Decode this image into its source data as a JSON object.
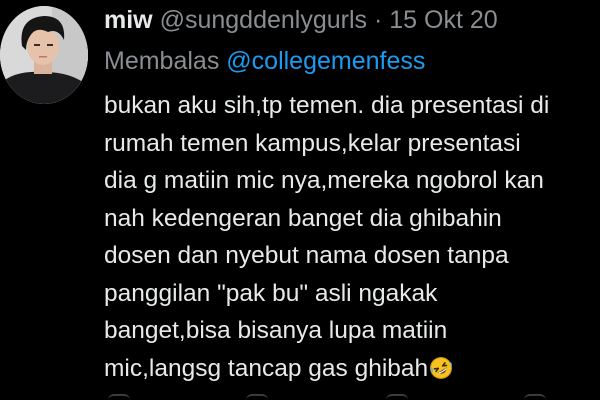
{
  "tweet": {
    "display_name": "miw",
    "handle": "@sungddenlygurls",
    "separator": "·",
    "date": "15 Okt 20",
    "reply_prefix": "Membalas",
    "reply_to": "@collegemenfess",
    "body_lines": [
      "bukan aku sih,tp temen. dia presentasi di",
      "rumah temen kampus,kelar presentasi",
      "dia g matiin mic nya,mereka ngobrol kan",
      "nah kedengeran banget dia ghibahin",
      "dosen dan nyebut nama dosen tanpa",
      "panggilan \"pak bu\" asli ngakak",
      "banget,bisa bisanya lupa matiin",
      "mic,langsg tancap gas ghibah"
    ],
    "body_emoji": "rolling-on-floor-laughing-emoji"
  },
  "colors": {
    "background": "#000000",
    "text": "#e7e9ea",
    "secondary": "#8a8d91",
    "mention": "#1d9bf0",
    "emoji": "#f7c21f"
  },
  "icons": {
    "avatar": "profile-photo",
    "actions": [
      "reply-icon",
      "retweet-icon",
      "like-icon",
      "share-icon"
    ]
  }
}
